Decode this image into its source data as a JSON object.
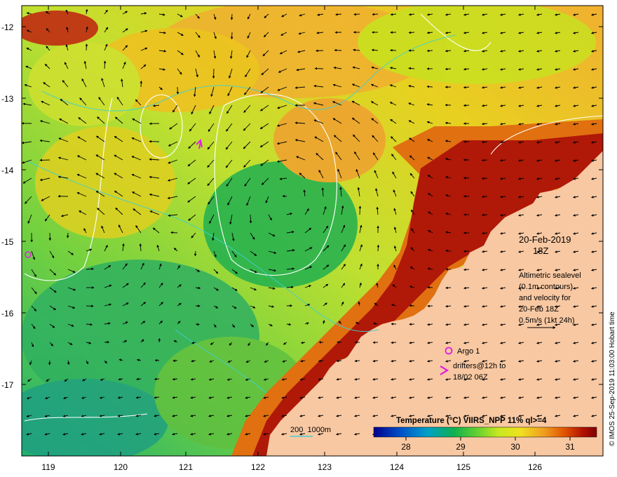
{
  "map": {
    "lat_ticks": [
      "-12",
      "-13",
      "-14",
      "-15",
      "-16",
      "-17"
    ],
    "lon_ticks": [
      "119",
      "120",
      "121",
      "122",
      "123",
      "124",
      "125",
      "126"
    ],
    "date": "20-Feb-2019",
    "time": "18Z",
    "altimetry_note": [
      "Altimetric sealevel",
      "(0.1m contours)",
      "and velocity for",
      "20-Feb 18Z",
      "0.5m/s (1kt 24h)"
    ],
    "legend_argo": "Argo 1",
    "legend_drifters": [
      "drifters@12h to",
      "18/02 06Z"
    ],
    "depth_label": "200  1000m",
    "colorbar_title": "Temperature (°C) VIIRS_NPP 11% ql>=4",
    "colorbar_ticks": [
      "28",
      "29",
      "30",
      "31"
    ],
    "credit": "© IMOS 25-Sep-2019 11:03:00 Hobart time"
  },
  "colors": {
    "land": "#f8c8a2",
    "argo_marker": "#e020e0",
    "contour": "#ffffff",
    "bathymetry": "#40d0d0",
    "arrow": "#000000",
    "sst_scale": [
      "#00008c",
      "#0050c8",
      "#00a0c8",
      "#10b050",
      "#60d030",
      "#c8e820",
      "#f0e020",
      "#f0a020",
      "#e05000",
      "#b01000",
      "#800000"
    ]
  }
}
